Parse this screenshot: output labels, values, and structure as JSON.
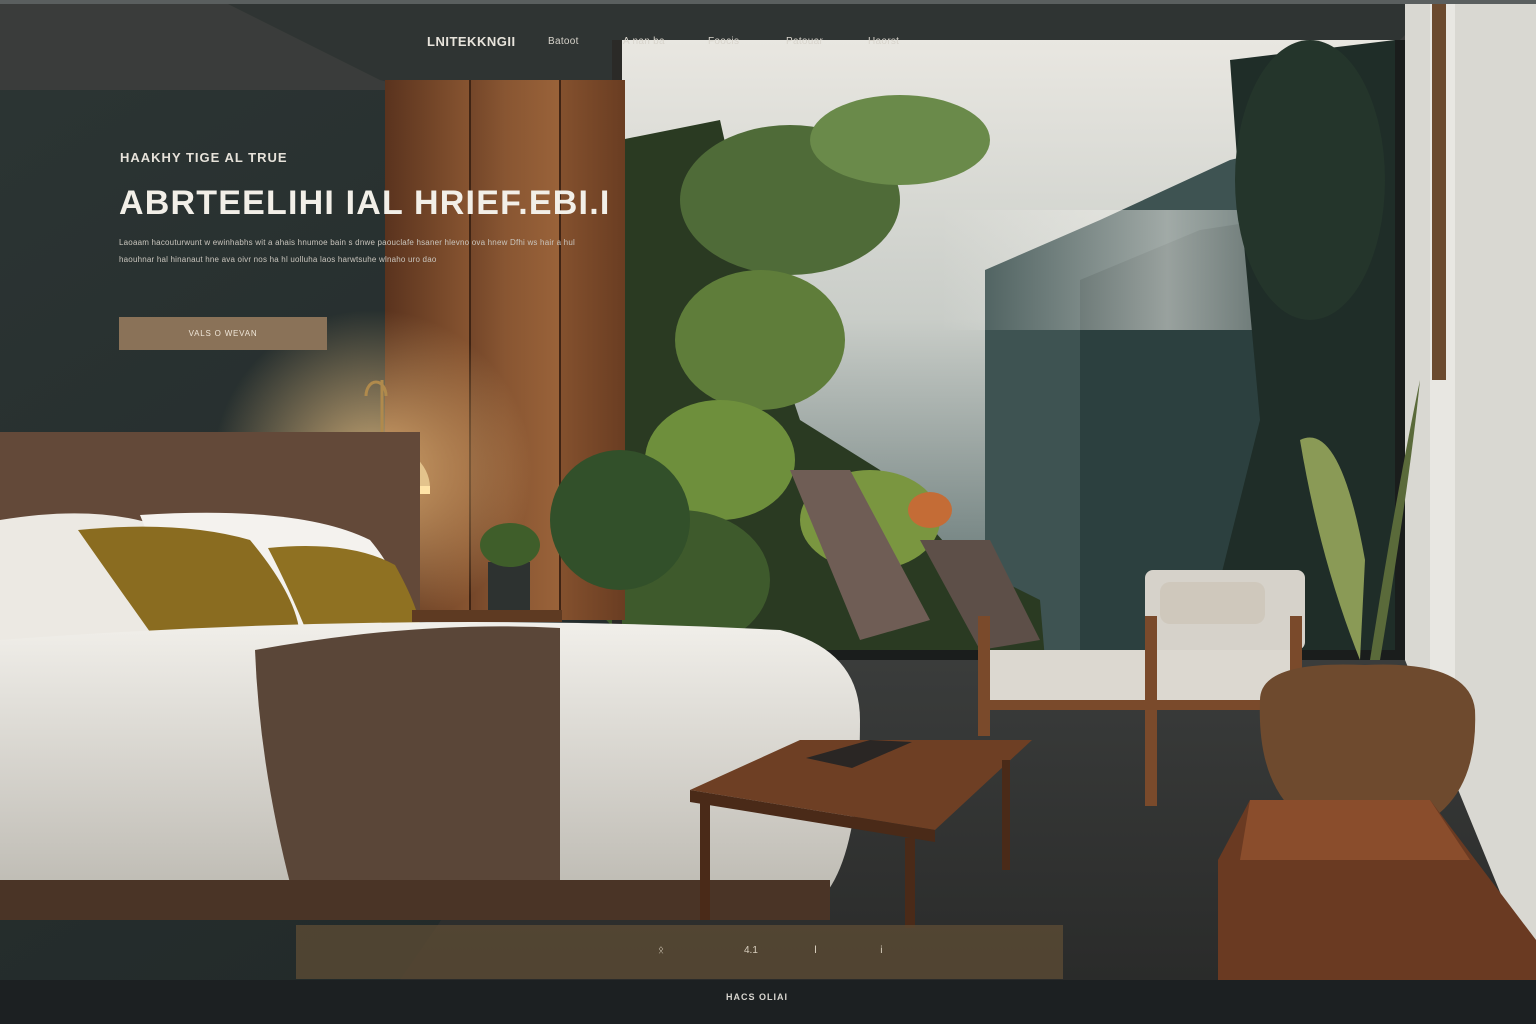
{
  "nav": {
    "brand": "LNITEKKNGII",
    "items": [
      "Batoot",
      "A nan ba",
      "Foocis",
      "Patouar",
      "Haorst"
    ]
  },
  "hero": {
    "eyebrow": "HAAKHY TIGE AL TRUE",
    "title": "ABRTEELIHI  IAL HRIEF.EBI.I",
    "description": "Laoaam hacouturwunt w ewinhabhs wit a ahais hnumoe bain s dnwe paouclafe hsaner hlevno ova hnew Dfhi ws hair a hul haouhnar hal hinanaut hne ava oivr nos ha hl uolluha laos harwtsuhe wlnaho uro dao",
    "cta": "VALS O WEVAN"
  },
  "bottom_bar": {
    "items": [
      "ᛟ",
      "4.1",
      "Ⅰ",
      "ⅰ"
    ]
  },
  "footer": {
    "text": "HACS OLIAI"
  },
  "colors": {
    "accent": "#8a7258",
    "bar": "#5c4c34",
    "footer": "#1c2022"
  }
}
